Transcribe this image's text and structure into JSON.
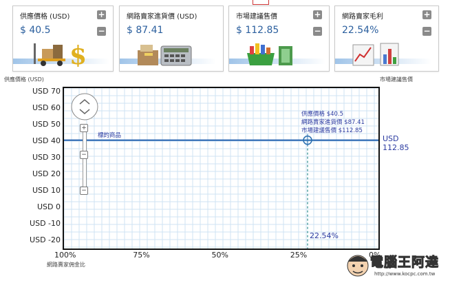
{
  "cards": [
    {
      "title": "供應價格 (USD)",
      "value": "$ 40.5",
      "icon": "forklift-dollar-icon"
    },
    {
      "title": "網路賣家進貨價 (USD)",
      "value": "$ 87.41",
      "icon": "cash-register-calculator-icon"
    },
    {
      "title": "市場建議售價",
      "value": "$ 112.85",
      "icon": "shopping-basket-money-icon"
    },
    {
      "title": "網路賣家毛利",
      "value": "22.54%",
      "icon": "bar-chart-icon"
    }
  ],
  "chart": {
    "ylabel": "供應價格 (USD)",
    "right_label": "市場建議售價",
    "xlabel": "網路賣家佣金比",
    "line_label": "標的商品",
    "right_value": "USD\n112.85",
    "right_value_top": "USD",
    "right_value_bottom": "112.85",
    "tooltip": [
      "供應價格 $40.5",
      "網路賣家進貨價 $87.41",
      "市場建議售價 $112.85"
    ],
    "x_marker_label": "22.54%",
    "watermark_main": "電腦王阿達",
    "watermark_url": "http://www.kocpc.com.tw",
    "accent": "#1f5fae"
  },
  "chart_data": {
    "type": "line",
    "ylabel": "供應價格 (USD)",
    "xlabel": "網路賣家佣金比",
    "y_ticks": [
      "USD 70",
      "USD 60",
      "USD 50",
      "USD 40",
      "USD 30",
      "USD 20",
      "USD 10",
      "USD 0",
      "USD -10",
      "USD -20"
    ],
    "x_ticks": [
      "100%",
      "75%",
      "50%",
      "25%",
      "0%"
    ],
    "ylim": [
      -25,
      72
    ],
    "xlim": [
      100,
      0
    ],
    "series": [
      {
        "name": "標的商品",
        "values": [
          [
            100,
            40.5
          ],
          [
            0,
            40.5
          ]
        ]
      }
    ],
    "marker": {
      "x": 22.54,
      "y": 40.5
    },
    "grid": true
  }
}
